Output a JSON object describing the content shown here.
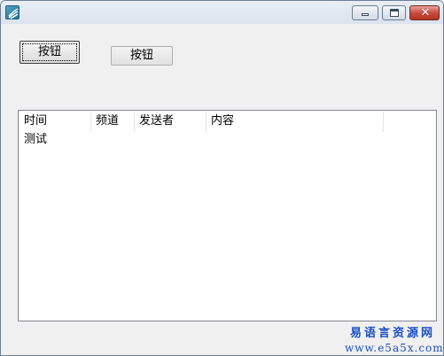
{
  "window": {
    "title": "",
    "controls": {
      "minimize_icon": "minimize-icon",
      "maximize_icon": "maximize-icon",
      "close_icon": "close-icon",
      "close_glyph": "✕"
    }
  },
  "buttons": [
    {
      "label": "按钮"
    },
    {
      "label": "按钮"
    }
  ],
  "listview": {
    "columns": [
      "时间",
      "频道",
      "发送者",
      "内容"
    ],
    "rows": [
      [
        "测试",
        "",
        "",
        ""
      ]
    ]
  },
  "watermark": {
    "name": "易语言资源网",
    "url": "www.e5a5x.com"
  },
  "colors": {
    "watermark": "#1a4fc2",
    "close_button": "#c7473a",
    "window_bg": "#f0f0f0"
  }
}
